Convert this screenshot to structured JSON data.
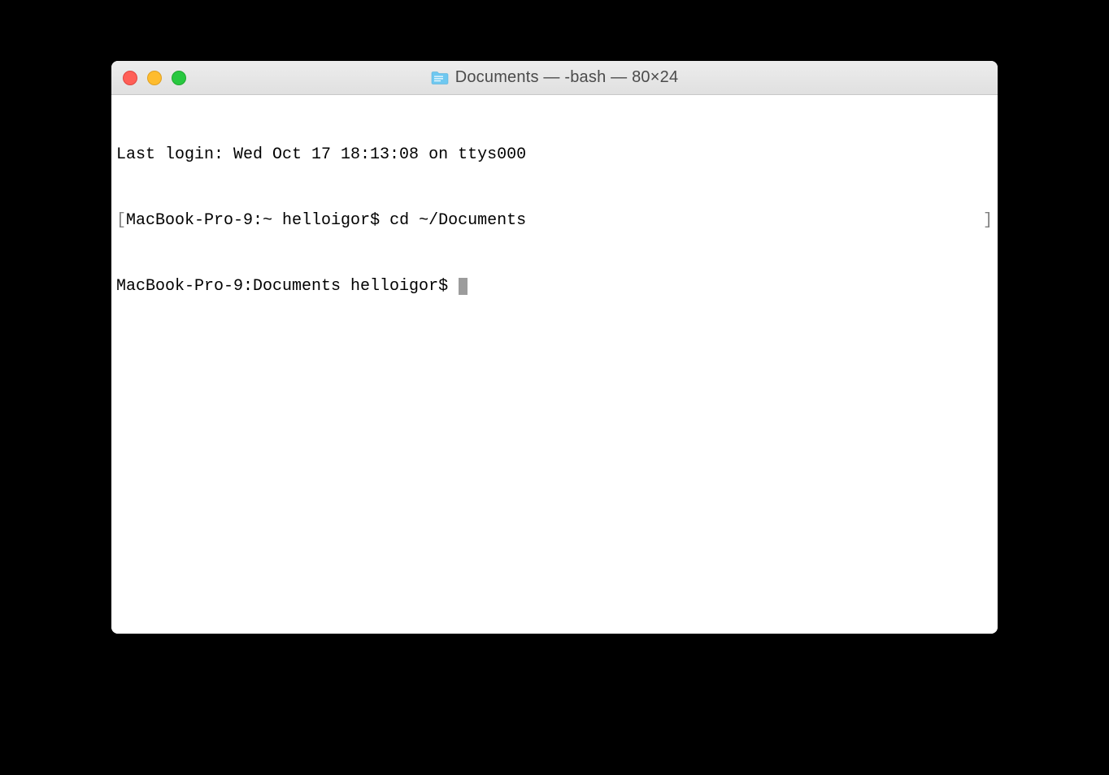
{
  "window": {
    "title": "Documents — -bash — 80×24"
  },
  "terminal": {
    "lines": {
      "line0": "Last login: Wed Oct 17 18:13:08 on ttys000",
      "line1_prompt": "MacBook-Pro-9:~ helloigor$ ",
      "line1_cmd": "cd ~/Documents",
      "line2_prompt": "MacBook-Pro-9:Documents helloigor$ "
    }
  }
}
